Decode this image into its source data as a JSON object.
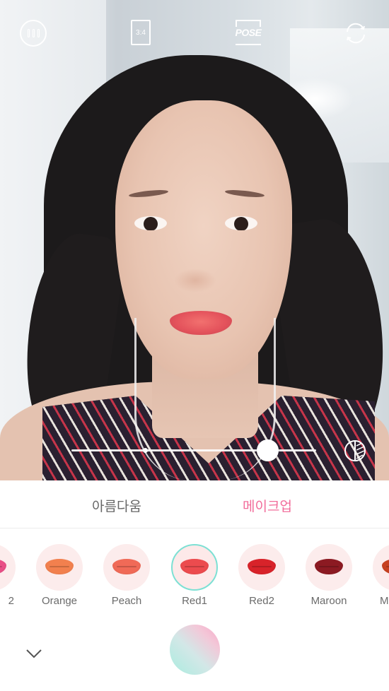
{
  "top_bar": {
    "menu_icon": "menu-icon",
    "aspect_ratio": "3:4",
    "pose_label": "POSE",
    "flip_icon": "camera-flip-icon"
  },
  "intensity_slider": {
    "value_fraction": 0.8,
    "compare_icon": "compare-icon"
  },
  "tabs": [
    {
      "label": "아름다움",
      "active": false
    },
    {
      "label": "메이크업",
      "active": true
    }
  ],
  "colors": {
    "accent_pink": "#f26d9b",
    "selected_ring": "#7de0d4"
  },
  "lip_colors": [
    {
      "label": "2",
      "color": "#e94e86",
      "selected": false
    },
    {
      "label": "Orange",
      "color": "#f2804e",
      "selected": false
    },
    {
      "label": "Peach",
      "color": "#f06a57",
      "selected": false
    },
    {
      "label": "Red1",
      "color": "#ec4b4e",
      "selected": true
    },
    {
      "label": "Red2",
      "color": "#d8232a",
      "selected": false
    },
    {
      "label": "Maroon",
      "color": "#8c1a22",
      "selected": false
    },
    {
      "label": "M",
      "color": "#c74120",
      "selected": false
    }
  ],
  "bottom_bar": {
    "collapse_icon": "chevron-down-icon",
    "shutter_icon": "shutter-button"
  }
}
